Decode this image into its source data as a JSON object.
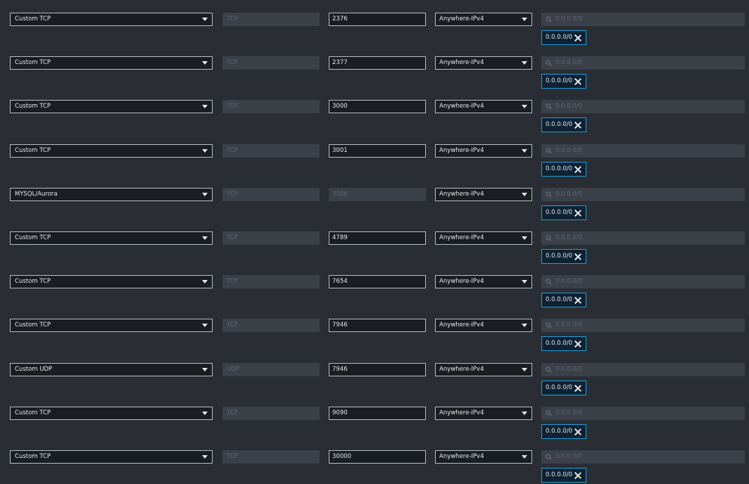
{
  "colors": {
    "background": "#2a2d33",
    "field": "#1a1d22",
    "field_border": "#b9c0c8",
    "disabled_field": "#3c4049",
    "token_border": "#1fa0d8"
  },
  "icons": {
    "dropdown": "caret-down-icon",
    "search": "search-icon",
    "remove_token": "close-icon"
  },
  "rules": [
    {
      "type": "Custom TCP",
      "protocol": "TCP",
      "port": "2376",
      "port_editable": true,
      "source": "Anywhere-IPv4",
      "cidr_placeholder": "0.0.0.0/0",
      "cidr_token": "0.0.0.0/0"
    },
    {
      "type": "Custom TCP",
      "protocol": "TCP",
      "port": "2377",
      "port_editable": true,
      "source": "Anywhere-IPv4",
      "cidr_placeholder": "0.0.0.0/0",
      "cidr_token": "0.0.0.0/0"
    },
    {
      "type": "Custom TCP",
      "protocol": "TCP",
      "port": "3000",
      "port_editable": true,
      "source": "Anywhere-IPv4",
      "cidr_placeholder": "0.0.0.0/0",
      "cidr_token": "0.0.0.0/0"
    },
    {
      "type": "Custom TCP",
      "protocol": "TCP",
      "port": "3001",
      "port_editable": true,
      "source": "Anywhere-IPv4",
      "cidr_placeholder": "0.0.0.0/0",
      "cidr_token": "0.0.0.0/0"
    },
    {
      "type": "MYSQL/Aurora",
      "protocol": "TCP",
      "port": "3306",
      "port_editable": false,
      "source": "Anywhere-IPv4",
      "cidr_placeholder": "0.0.0.0/0",
      "cidr_token": "0.0.0.0/0"
    },
    {
      "type": "Custom TCP",
      "protocol": "TCP",
      "port": "4789",
      "port_editable": true,
      "source": "Anywhere-IPv4",
      "cidr_placeholder": "0.0.0.0/0",
      "cidr_token": "0.0.0.0/0"
    },
    {
      "type": "Custom TCP",
      "protocol": "TCP",
      "port": "7654",
      "port_editable": true,
      "source": "Anywhere-IPv4",
      "cidr_placeholder": "0.0.0.0/0",
      "cidr_token": "0.0.0.0/0"
    },
    {
      "type": "Custom TCP",
      "protocol": "TCP",
      "port": "7946",
      "port_editable": true,
      "source": "Anywhere-IPv4",
      "cidr_placeholder": "0.0.0.0/0",
      "cidr_token": "0.0.0.0/0"
    },
    {
      "type": "Custom UDP",
      "protocol": "UDP",
      "port": "7946",
      "port_editable": true,
      "source": "Anywhere-IPv4",
      "cidr_placeholder": "0.0.0.0/0",
      "cidr_token": "0.0.0.0/0"
    },
    {
      "type": "Custom TCP",
      "protocol": "TCP",
      "port": "9090",
      "port_editable": true,
      "source": "Anywhere-IPv4",
      "cidr_placeholder": "0.0.0.0/0",
      "cidr_token": "0.0.0.0/0"
    },
    {
      "type": "Custom TCP",
      "protocol": "TCP",
      "port": "30000",
      "port_editable": true,
      "source": "Anywhere-IPv4",
      "cidr_placeholder": "0.0.0.0/0",
      "cidr_token": "0.0.0.0/0"
    }
  ]
}
